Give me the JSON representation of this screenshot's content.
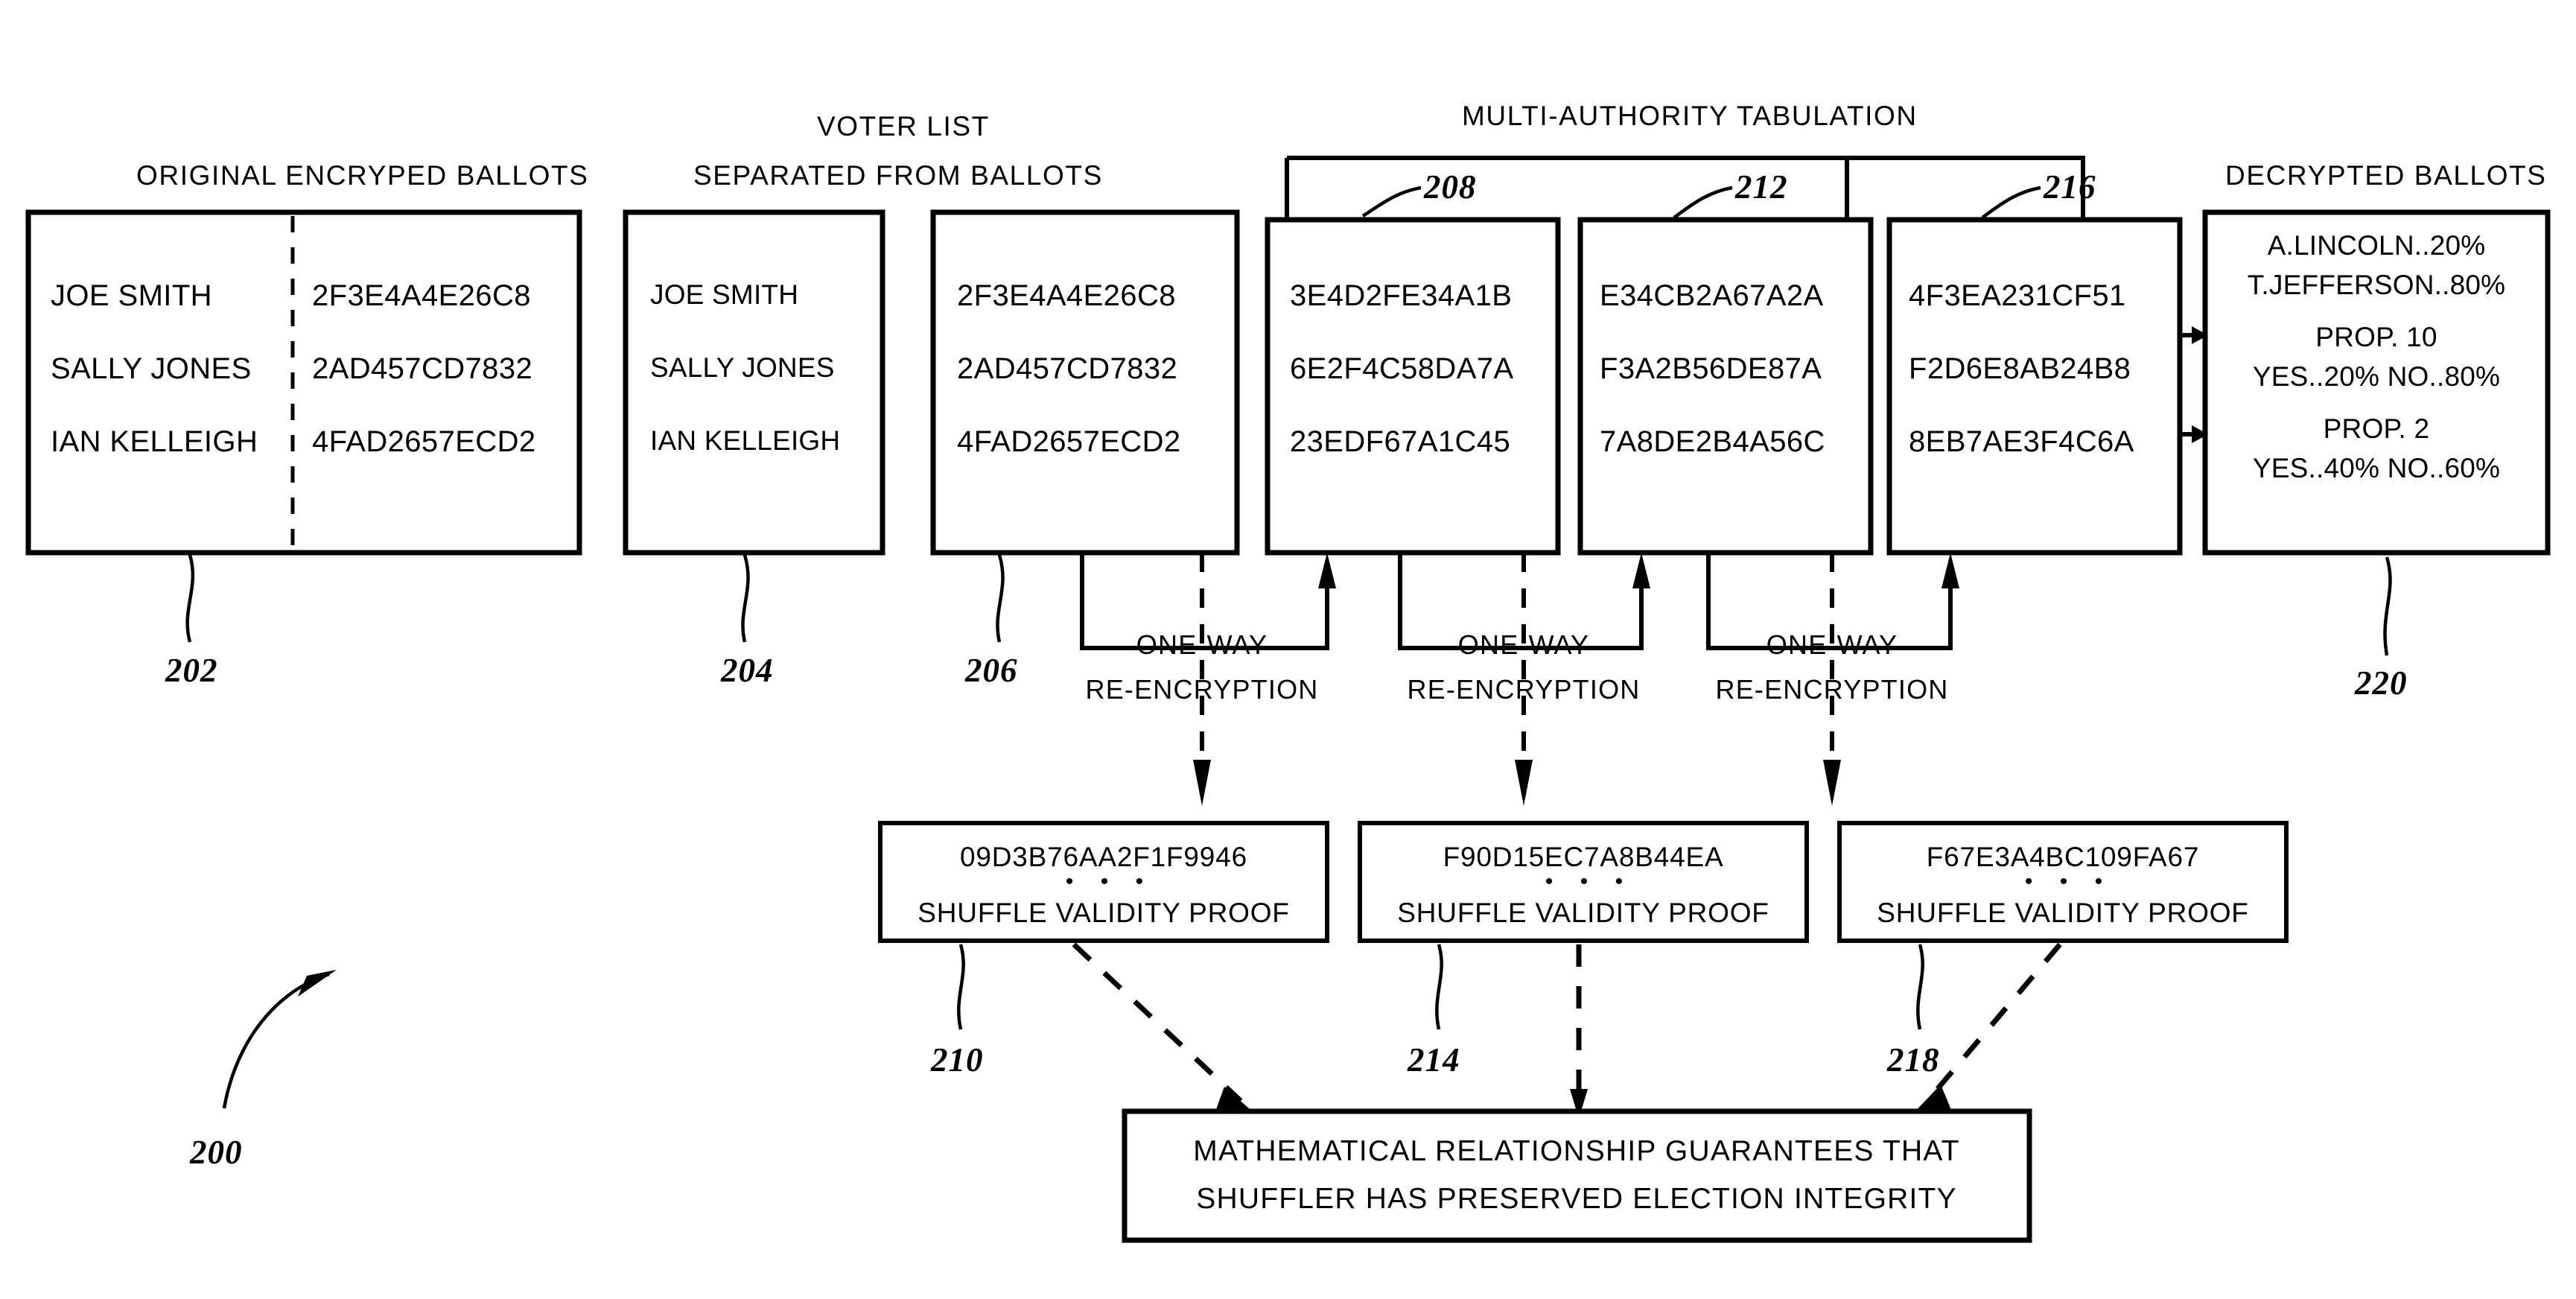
{
  "figure": {
    "ref": "200",
    "panels": {
      "original": {
        "title": "ORIGINAL ENCRYPED BALLOTS",
        "ref": "202",
        "names": [
          "JOE SMITH",
          "SALLY JONES",
          "IAN  KELLEIGH"
        ],
        "codes": [
          "2F3E4A4E26C8",
          "2AD457CD7832",
          "4FAD2657ECD2"
        ]
      },
      "separated": {
        "title_line1": "VOTER LIST",
        "title_line2": "SEPARATED FROM BALLOTS",
        "voters_ref": "204",
        "ballots_ref": "206",
        "names": [
          "JOE SMITH",
          "SALLY JONES",
          "IAN KELLEIGH"
        ],
        "codes": [
          "2F3E4A4E26C8",
          "2AD457CD7832",
          "4FAD2657ECD2"
        ]
      },
      "tabulation": {
        "title": "MULTI-AUTHORITY TABULATION",
        "stages": [
          {
            "ref": "208",
            "codes": [
              "3E4D2FE34A1B",
              "6E2F4C58DA7A",
              "23EDF67A1C45"
            ]
          },
          {
            "ref": "212",
            "codes": [
              "E34CB2A67A2A",
              "F3A2B56DE87A",
              "7A8DE2B4A56C"
            ]
          },
          {
            "ref": "216",
            "codes": [
              "4F3EA231CF51",
              "F2D6E8AB24B8",
              "8EB7AE3F4C6A"
            ]
          }
        ]
      },
      "decrypted": {
        "title": "DECRYPTED BALLOTS",
        "ref": "220",
        "lines": [
          "A.LINCOLN..20%",
          "T.JEFFERSON..80%",
          "PROP. 10",
          "YES..20% NO..80%",
          "PROP. 2",
          "YES..40% NO..60%"
        ]
      }
    },
    "reencryption": {
      "label_line1": "ONE-WAY",
      "label_line2": "RE-ENCRYPTION",
      "count": 3
    },
    "proofs": [
      {
        "ref": "210",
        "code": "09D3B76AA2F1F9946",
        "ellipsis": "• • •",
        "label": "SHUFFLE VALIDITY PROOF"
      },
      {
        "ref": "214",
        "code": "F90D15EC7A8B44EA",
        "ellipsis": "• • •",
        "label": "SHUFFLE VALIDITY PROOF"
      },
      {
        "ref": "218",
        "code": "F67E3A4BC109FA67",
        "ellipsis": "• • •",
        "label": "SHUFFLE VALIDITY PROOF"
      }
    ],
    "conclusion": {
      "line1": "MATHEMATICAL RELATIONSHIP GUARANTEES THAT",
      "line2": "SHUFFLER HAS PRESERVED ELECTION INTEGRITY"
    },
    "colors": {
      "ink": "#000000",
      "paper": "#ffffff"
    }
  }
}
